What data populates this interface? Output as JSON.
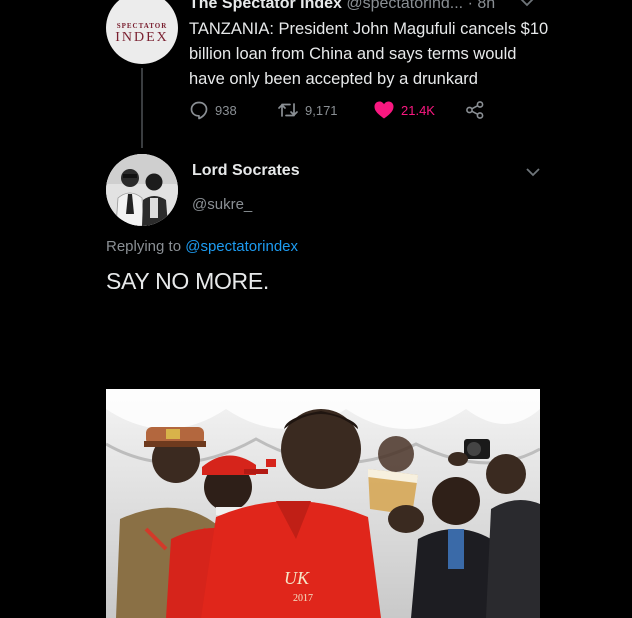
{
  "original_tweet": {
    "avatar_logo_top": "SPECTATOR",
    "avatar_logo_bottom": "INDEX",
    "name": "The Spectator Index",
    "handle": "@spectatorind...",
    "time": "· 8h",
    "text": "TANZANIA: President John Magufuli cancels $10 billion loan from China and says terms would have only been accepted by a drunkard",
    "replies": "938",
    "retweets": "9,171",
    "likes": "21.4K",
    "liked": true,
    "colors": {
      "like": "#f91880",
      "muted": "#8a8f94"
    },
    "icons": [
      "reply-icon",
      "retweet-icon",
      "heart-icon",
      "share-icon",
      "chevron-down-icon"
    ]
  },
  "reply_tweet": {
    "name": "Lord Socrates",
    "handle": "@sukre_",
    "replying_prefix": "Replying to",
    "replying_mention": "@spectatorindex",
    "text": "SAY NO MORE.",
    "colors": {
      "mention": "#1d9bf0"
    }
  },
  "photo": {
    "shirt_label": "UK",
    "shirt_year": "2017"
  }
}
